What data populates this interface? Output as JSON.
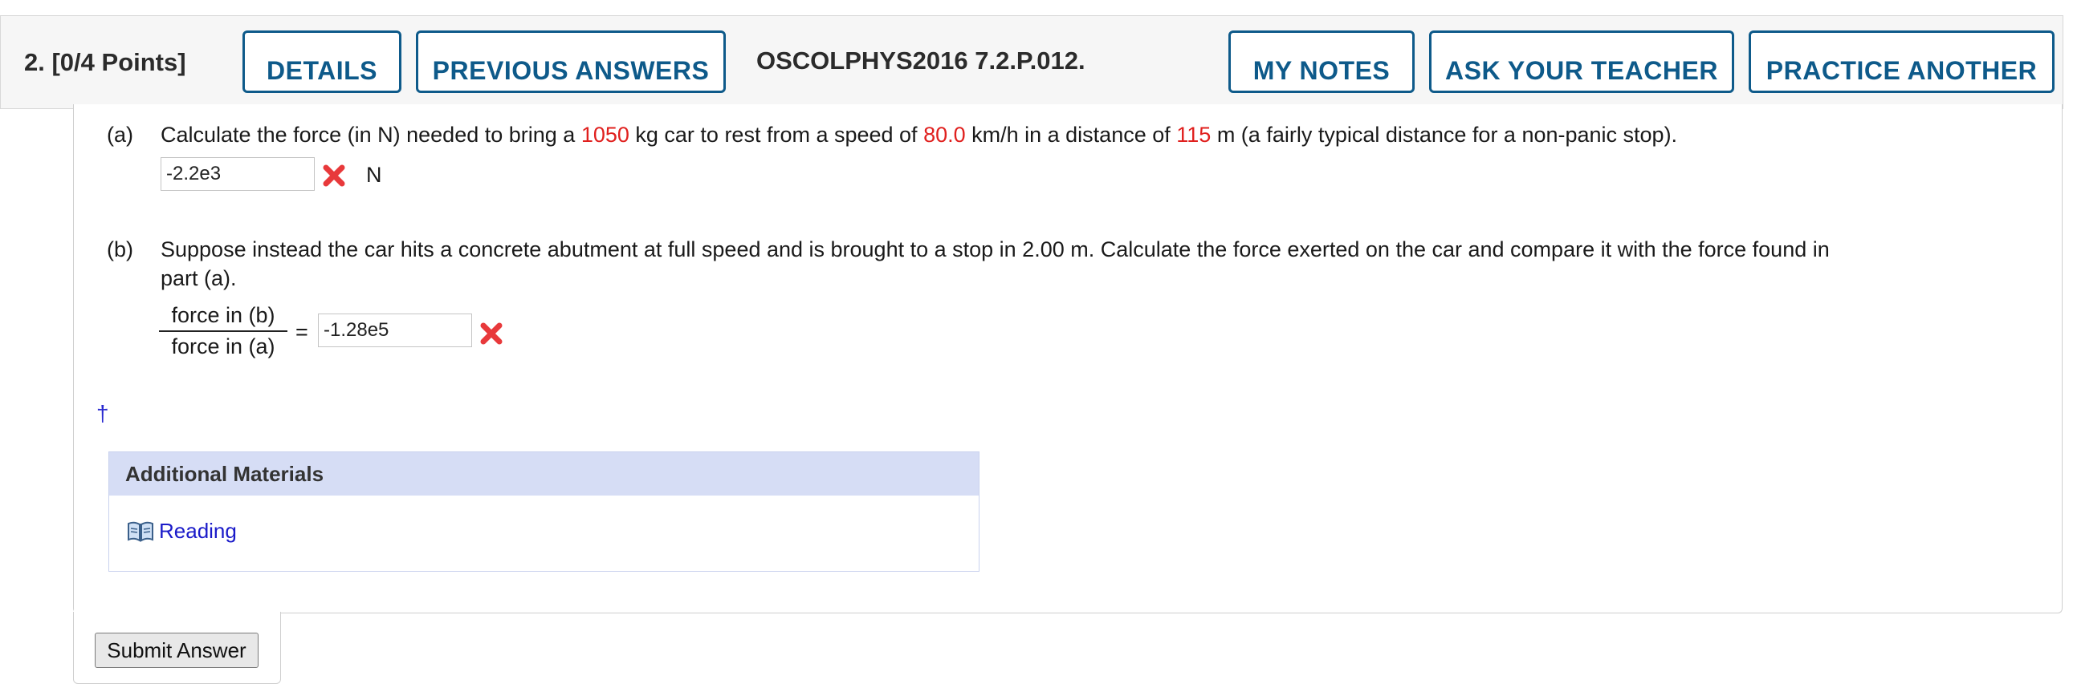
{
  "header": {
    "question_number": "2.",
    "points": "[0/4 Points]",
    "details_label": "DETAILS",
    "previous_answers_label": "PREVIOUS ANSWERS",
    "problem_code": "OSCOLPHYS2016 7.2.P.012.",
    "my_notes_label": "MY NOTES",
    "ask_teacher_label": "ASK YOUR TEACHER",
    "practice_another_label": "PRACTICE ANOTHER"
  },
  "part_a": {
    "label": "(a)",
    "text_1": "Calculate the force (in N) needed to bring a ",
    "mass": "1050",
    "text_2": " kg car to rest from a speed of ",
    "speed": "80.0",
    "text_3": " km/h in a distance of ",
    "distance": "115",
    "text_4": " m (a fairly typical distance for a non-panic stop).",
    "answer": "-2.2e3",
    "unit": "N",
    "status_icon": "incorrect-x-icon"
  },
  "part_b": {
    "label": "(b)",
    "text_line1": "Suppose instead the car hits a concrete abutment at full speed and is brought to a stop in 2.00 m. Calculate the force exerted on the car and compare it with the force found in",
    "text_line2": "part (a).",
    "fraction_numerator": "force in (b)",
    "fraction_denominator": "force in (a)",
    "equals": "=",
    "answer": "-1.28e5",
    "status_icon": "incorrect-x-icon"
  },
  "dagger": "†",
  "additional_materials": {
    "title": "Additional Materials",
    "link_label": "Reading",
    "link_icon": "book-icon"
  },
  "submit_label": "Submit Answer",
  "colors": {
    "accent_blue": "#0e5a8a",
    "highlight_red": "#e0201e",
    "link_blue": "#1a1ac9",
    "materials_header": "#d6ddf5"
  }
}
